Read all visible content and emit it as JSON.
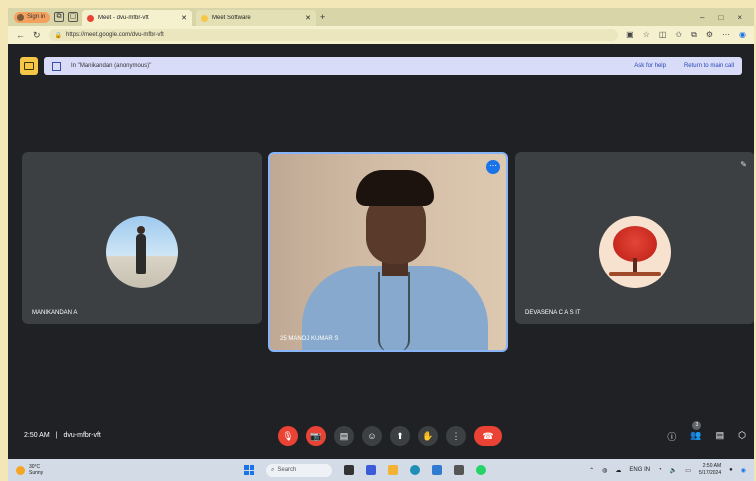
{
  "browser": {
    "tabs": [
      {
        "title": "Meet - dvu-mfbr-vft",
        "active": true,
        "favicon_color": "#ea4335"
      },
      {
        "title": "Meet Software",
        "active": false,
        "favicon_color": "#f6c646"
      }
    ],
    "url": "https://meet.google.com/dvu-mfbr-vft",
    "new_tab": "+",
    "win_controls": [
      "–",
      "□",
      "×"
    ]
  },
  "banner": {
    "presenter": "Manikandan (anonymous)",
    "ask_help": "Ask for help",
    "return_main": "Return to main call"
  },
  "participants": [
    {
      "name": "MANIKANDAN A",
      "avatar": "person-photo"
    },
    {
      "name": "25 MANOJ KUMAR S",
      "avatar": "camera-video"
    },
    {
      "name": "DEVASENA C A S IT",
      "avatar": "red-tree"
    }
  ],
  "footer": {
    "time": "2:50 AM",
    "separator": "|",
    "meeting_code": "dvu-mfbr-vft",
    "participant_count": "3"
  },
  "controls": [
    {
      "name": "mic-off-icon",
      "glyph": "🎙"
    },
    {
      "name": "camera-off-icon",
      "glyph": "📷"
    },
    {
      "name": "captions-icon",
      "glyph": "▤"
    },
    {
      "name": "emoji-icon",
      "glyph": "☺"
    },
    {
      "name": "present-icon",
      "glyph": "⬆"
    },
    {
      "name": "raise-hand-icon",
      "glyph": "✋"
    },
    {
      "name": "more-options-icon",
      "glyph": "⋮"
    },
    {
      "name": "leave-call-icon",
      "glyph": "☎"
    }
  ],
  "taskbar": {
    "weather_temp": "30°C",
    "weather_desc": "Sunny",
    "search_placeholder": "Search",
    "clock_time": "2:50 AM",
    "clock_date": "5/17/2024",
    "lang": "ENG IN"
  },
  "colors": {
    "accent": "#1a73e8",
    "danger": "#ea4335",
    "tile_bg": "#3c4043",
    "meet_bg": "#202124"
  }
}
